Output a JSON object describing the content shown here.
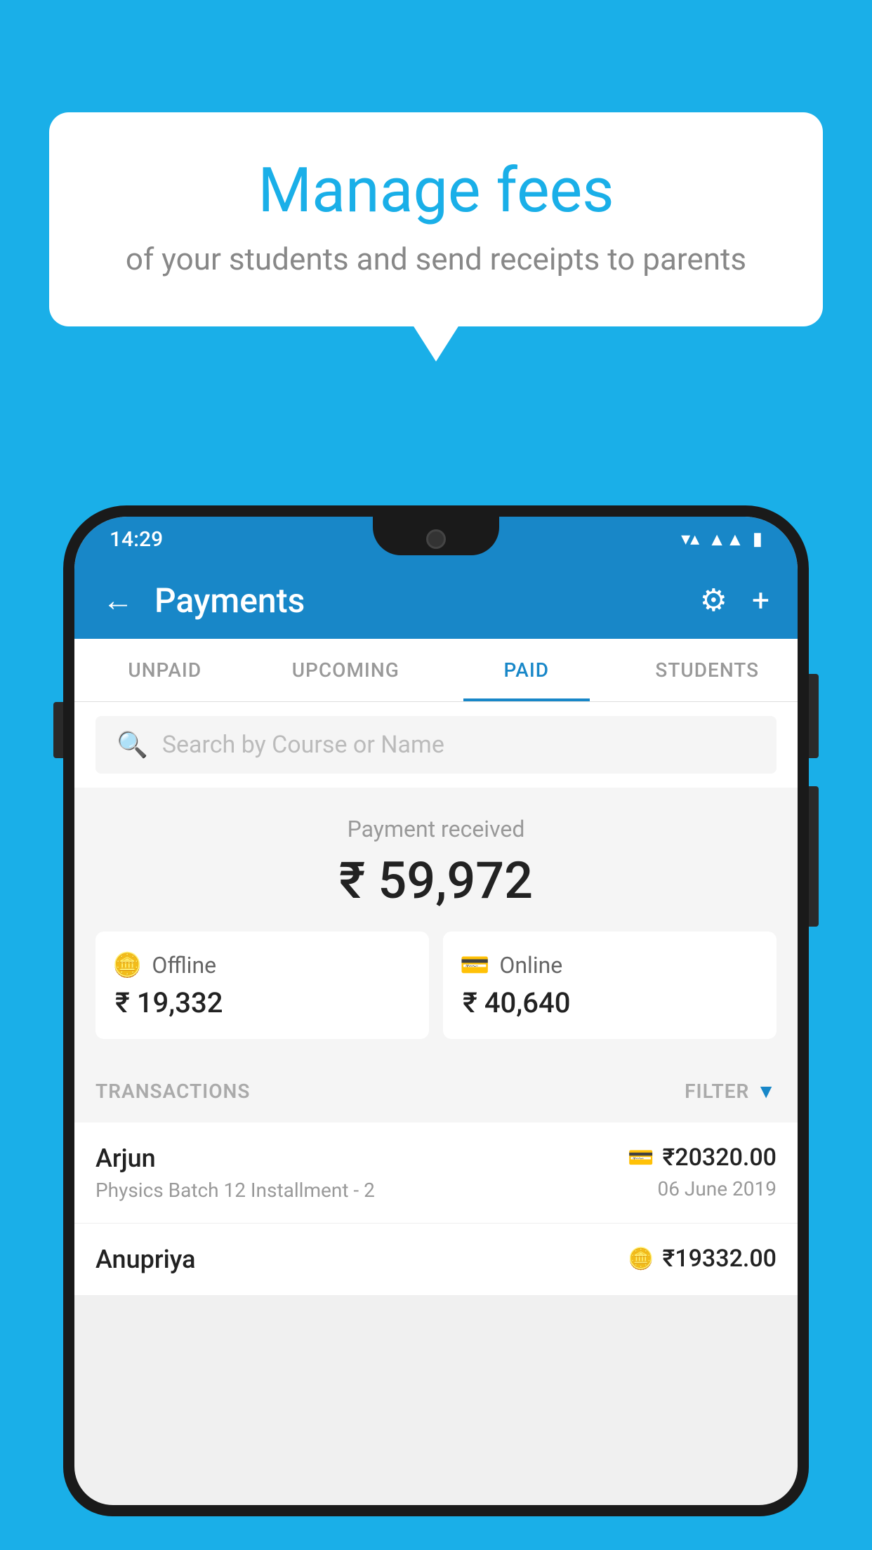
{
  "bubble": {
    "title": "Manage fees",
    "subtitle": "of your students and send receipts to parents"
  },
  "status_bar": {
    "time": "14:29",
    "wifi": "▼",
    "signal": "▲",
    "battery": "▮"
  },
  "app_bar": {
    "title": "Payments",
    "back_label": "←",
    "gear_label": "⚙",
    "plus_label": "+"
  },
  "tabs": [
    {
      "label": "UNPAID",
      "active": false
    },
    {
      "label": "UPCOMING",
      "active": false
    },
    {
      "label": "PAID",
      "active": true
    },
    {
      "label": "STUDENTS",
      "active": false
    }
  ],
  "search": {
    "placeholder": "Search by Course or Name"
  },
  "payment_summary": {
    "label": "Payment received",
    "amount": "₹ 59,972",
    "offline_label": "Offline",
    "offline_amount": "₹ 19,332",
    "online_label": "Online",
    "online_amount": "₹ 40,640"
  },
  "transactions": {
    "header_label": "TRANSACTIONS",
    "filter_label": "FILTER",
    "items": [
      {
        "name": "Arjun",
        "detail": "Physics Batch 12 Installment - 2",
        "amount": "₹20320.00",
        "date": "06 June 2019",
        "icon": "card"
      },
      {
        "name": "Anupriya",
        "detail": "",
        "amount": "₹19332.00",
        "date": "",
        "icon": "cash"
      }
    ]
  }
}
